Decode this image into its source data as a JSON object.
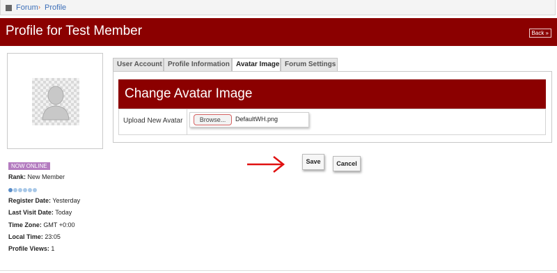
{
  "breadcrumb": {
    "forum": "Forum",
    "separator": "›",
    "profile": "Profile"
  },
  "header": {
    "title": "Profile for Test Member",
    "back_label": "Back »"
  },
  "sidebar": {
    "status_badge": "NOW ONLINE",
    "rank_label": "Rank:",
    "rank_value": "New Member",
    "rank_level": {
      "filled": 1,
      "total": 6
    },
    "register_label": "Register Date:",
    "register_value": "Yesterday",
    "last_visit_label": "Last Visit Date:",
    "last_visit_value": "Today",
    "timezone_label": "Time Zone:",
    "timezone_value": "GMT +0:00",
    "local_time_label": "Local Time:",
    "local_time_value": "23:05",
    "views_label": "Profile Views:",
    "views_value": "1"
  },
  "tabs": [
    {
      "label": "User Account"
    },
    {
      "label": "Profile Information"
    },
    {
      "label": "Avatar Image",
      "active": true
    },
    {
      "label": "Forum Settings"
    }
  ],
  "panel": {
    "title": "Change Avatar Image",
    "upload_label": "Upload New Avatar",
    "browse_label": "Browse...",
    "file_name": "DefaultWH.png"
  },
  "actions": {
    "save_label": "Save",
    "cancel_label": "Cancel"
  },
  "colors": {
    "header_red": "#8b0000",
    "link_blue": "#3d6fb8",
    "badge_purple": "#b47cc0",
    "arrow_red": "#e01010"
  }
}
